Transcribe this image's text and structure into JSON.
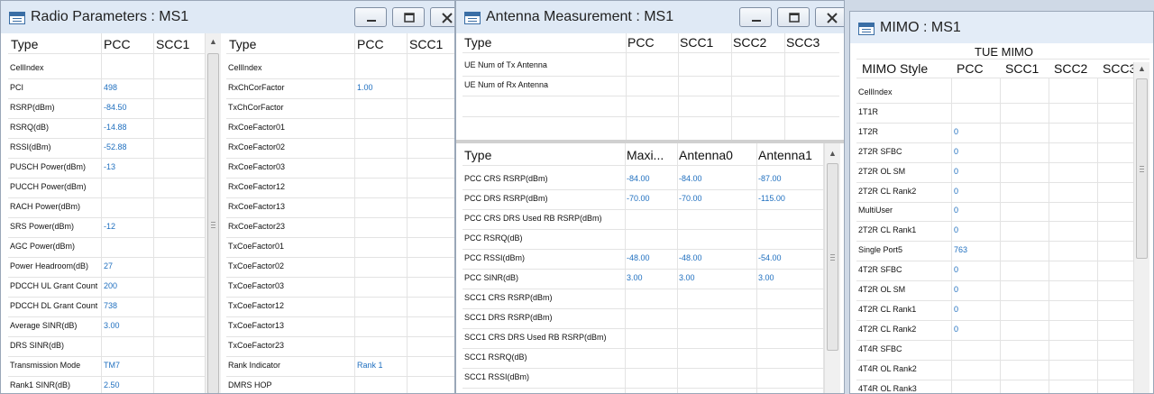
{
  "radio": {
    "title": "Radio Parameters : MS1",
    "col_type": "Type",
    "col_pcc": "PCC",
    "col_scc1": "SCC1",
    "rows": [
      {
        "label": "CellIndex",
        "value": ""
      },
      {
        "label": "PCI",
        "value": "498"
      },
      {
        "label": "RSRP(dBm)",
        "value": "-84.50"
      },
      {
        "label": "RSRQ(dB)",
        "value": "-14.88"
      },
      {
        "label": "RSSI(dBm)",
        "value": "-52.88"
      },
      {
        "label": "PUSCH Power(dBm)",
        "value": "-13"
      },
      {
        "label": "PUCCH Power(dBm)",
        "value": ""
      },
      {
        "label": "RACH Power(dBm)",
        "value": ""
      },
      {
        "label": "SRS Power(dBm)",
        "value": "-12"
      },
      {
        "label": "AGC Power(dBm)",
        "value": ""
      },
      {
        "label": "Power Headroom(dB)",
        "value": "27"
      },
      {
        "label": "PDCCH UL Grant Count",
        "value": "200"
      },
      {
        "label": "PDCCH DL Grant Count",
        "value": "738"
      },
      {
        "label": "Average SINR(dB)",
        "value": "3.00"
      },
      {
        "label": "DRS SINR(dB)",
        "value": ""
      },
      {
        "label": "Transmission Mode",
        "value": "TM7"
      },
      {
        "label": "Rank1 SINR(dB)",
        "value": "2.50"
      }
    ],
    "rows2": [
      {
        "label": "CellIndex",
        "value": ""
      },
      {
        "label": "RxChCorFactor",
        "value": "1.00"
      },
      {
        "label": "TxChCorFactor",
        "value": ""
      },
      {
        "label": "RxCoeFactor01",
        "value": ""
      },
      {
        "label": "RxCoeFactor02",
        "value": ""
      },
      {
        "label": "RxCoeFactor03",
        "value": ""
      },
      {
        "label": "RxCoeFactor12",
        "value": ""
      },
      {
        "label": "RxCoeFactor13",
        "value": ""
      },
      {
        "label": "RxCoeFactor23",
        "value": ""
      },
      {
        "label": "TxCoeFactor01",
        "value": ""
      },
      {
        "label": "TxCoeFactor02",
        "value": ""
      },
      {
        "label": "TxCoeFactor03",
        "value": ""
      },
      {
        "label": "TxCoeFactor12",
        "value": ""
      },
      {
        "label": "TxCoeFactor13",
        "value": ""
      },
      {
        "label": "TxCoeFactor23",
        "value": ""
      },
      {
        "label": "Rank Indicator",
        "value": "Rank 1"
      },
      {
        "label": "DMRS HOP",
        "value": ""
      }
    ]
  },
  "antenna": {
    "title": "Antenna Measurement : MS1",
    "top_headers": [
      "Type",
      "PCC",
      "SCC1",
      "SCC2",
      "SCC3"
    ],
    "top_rows": [
      "UE Num of Tx Antenna",
      "UE Num of Rx Antenna"
    ],
    "bottom_headers": [
      "Type",
      "Maxi...",
      "Antenna0",
      "Antenna1"
    ],
    "bottom_rows": [
      {
        "label": "PCC CRS RSRP(dBm)",
        "max": "-84.00",
        "a0": "-84.00",
        "a1": "-87.00"
      },
      {
        "label": "PCC DRS RSRP(dBm)",
        "max": "-70.00",
        "a0": "-70.00",
        "a1": "-115.00"
      },
      {
        "label": "PCC CRS DRS Used RB RSRP(dBm)",
        "max": "",
        "a0": "",
        "a1": ""
      },
      {
        "label": "PCC RSRQ(dB)",
        "max": "",
        "a0": "",
        "a1": ""
      },
      {
        "label": "PCC RSSI(dBm)",
        "max": "-48.00",
        "a0": "-48.00",
        "a1": "-54.00"
      },
      {
        "label": "PCC SINR(dB)",
        "max": "3.00",
        "a0": "3.00",
        "a1": "3.00"
      },
      {
        "label": "SCC1 CRS RSRP(dBm)",
        "max": "",
        "a0": "",
        "a1": ""
      },
      {
        "label": "SCC1 DRS RSRP(dBm)",
        "max": "",
        "a0": "",
        "a1": ""
      },
      {
        "label": "SCC1 CRS DRS Used RB RSRP(dBm)",
        "max": "",
        "a0": "",
        "a1": ""
      },
      {
        "label": "SCC1 RSRQ(dB)",
        "max": "",
        "a0": "",
        "a1": ""
      },
      {
        "label": "SCC1 RSSI(dBm)",
        "max": "",
        "a0": "",
        "a1": ""
      }
    ]
  },
  "mimo": {
    "title": "MIMO : MS1",
    "group_header": "TUE MIMO",
    "headers": [
      "MIMO Style",
      "PCC",
      "SCC1",
      "SCC2",
      "SCC3"
    ],
    "rows": [
      {
        "label": "CellIndex",
        "value": ""
      },
      {
        "label": "1T1R",
        "value": ""
      },
      {
        "label": "1T2R",
        "value": "0"
      },
      {
        "label": "2T2R SFBC",
        "value": "0"
      },
      {
        "label": "2T2R OL SM",
        "value": "0"
      },
      {
        "label": "2T2R CL Rank2",
        "value": "0"
      },
      {
        "label": "MultiUser",
        "value": "0"
      },
      {
        "label": "2T2R CL Rank1",
        "value": "0"
      },
      {
        "label": "Single Port5",
        "value": "763"
      },
      {
        "label": "4T2R SFBC",
        "value": "0"
      },
      {
        "label": "4T2R OL SM",
        "value": "0"
      },
      {
        "label": "4T2R CL Rank1",
        "value": "0"
      },
      {
        "label": "4T2R CL Rank2",
        "value": "0"
      },
      {
        "label": "4T4R SFBC",
        "value": ""
      },
      {
        "label": "4T4R OL Rank2",
        "value": ""
      },
      {
        "label": "4T4R OL Rank3",
        "value": ""
      }
    ]
  }
}
